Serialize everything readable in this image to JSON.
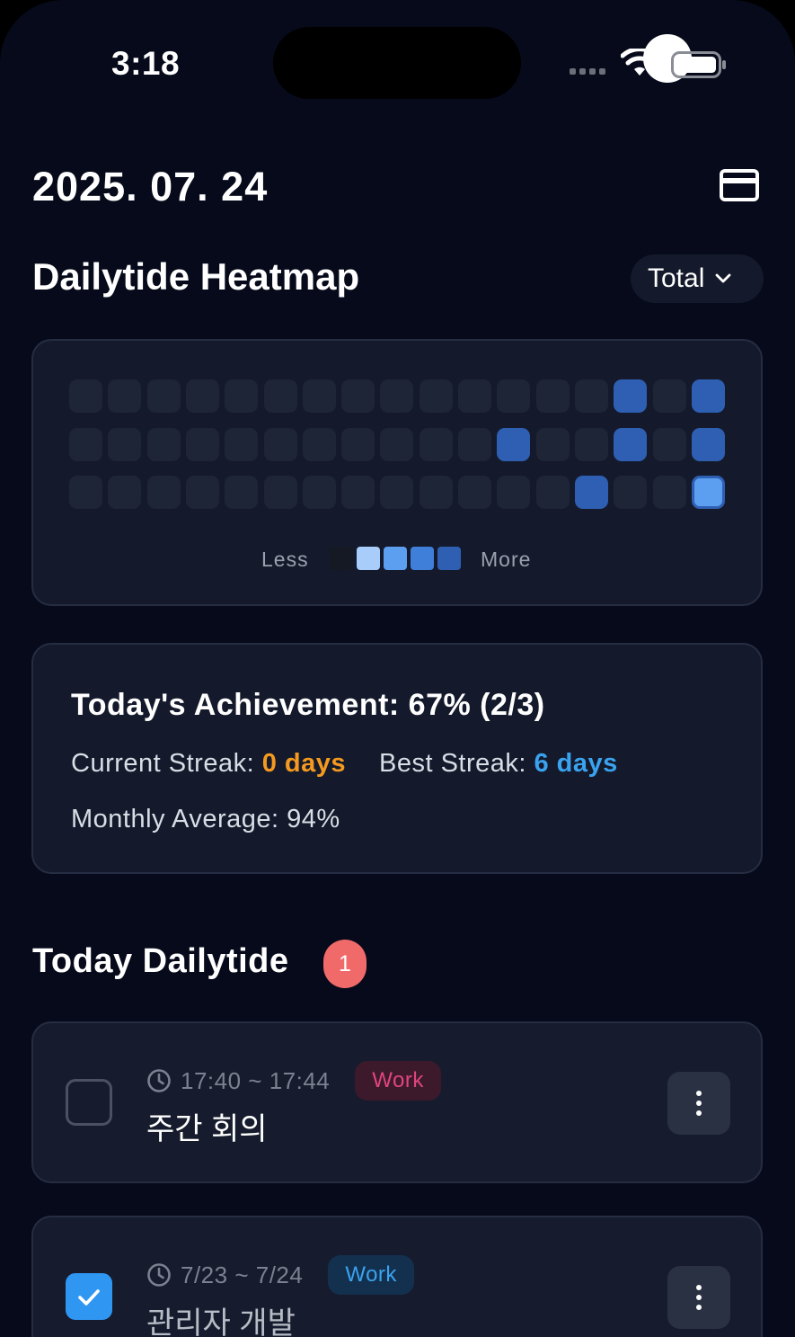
{
  "status_bar": {
    "time": "3:18"
  },
  "header": {
    "date": "2025. 07. 24",
    "card_icon": "credit-card-icon"
  },
  "heatmap": {
    "title": "Dailytide Heatmap",
    "filter_label": "Total",
    "legend_less": "Less",
    "legend_more": "More",
    "columns": 17,
    "rows": [
      [
        0,
        0,
        0,
        0,
        0,
        0,
        0,
        0,
        0,
        0,
        0,
        0,
        0,
        0,
        4,
        0,
        4
      ],
      [
        0,
        0,
        0,
        0,
        0,
        0,
        0,
        0,
        0,
        0,
        0,
        4,
        0,
        0,
        4,
        0,
        4
      ],
      [
        0,
        0,
        0,
        0,
        0,
        0,
        0,
        0,
        0,
        0,
        0,
        0,
        0,
        4,
        0,
        0,
        2
      ]
    ],
    "highlighted_cell": {
      "row": 2,
      "col": 16
    },
    "level_colors": [
      "#1e2536",
      "#a9cdfb",
      "#5c9ff0",
      "#3f7fd9",
      "#2f5fb3"
    ]
  },
  "achievement": {
    "title": "Today's Achievement: 67% (2/3)",
    "current_streak_label": "Current Streak: ",
    "current_streak_value": "0 days",
    "best_streak_label": "Best Streak: ",
    "best_streak_value": "6 days",
    "monthly_average": "Monthly Average: 94%"
  },
  "today": {
    "title": "Today Dailytide",
    "badge_count": "1",
    "tasks": [
      {
        "time": "17:40 ~ 17:44",
        "tag": "Work",
        "tag_color": "#e0447f",
        "title": "주간 회의",
        "checked": false
      },
      {
        "time": "7/23 ~ 7/24",
        "tag": "Work",
        "tag_color": "#3aa3ef",
        "title": "관리자 개발",
        "checked": true
      }
    ]
  }
}
